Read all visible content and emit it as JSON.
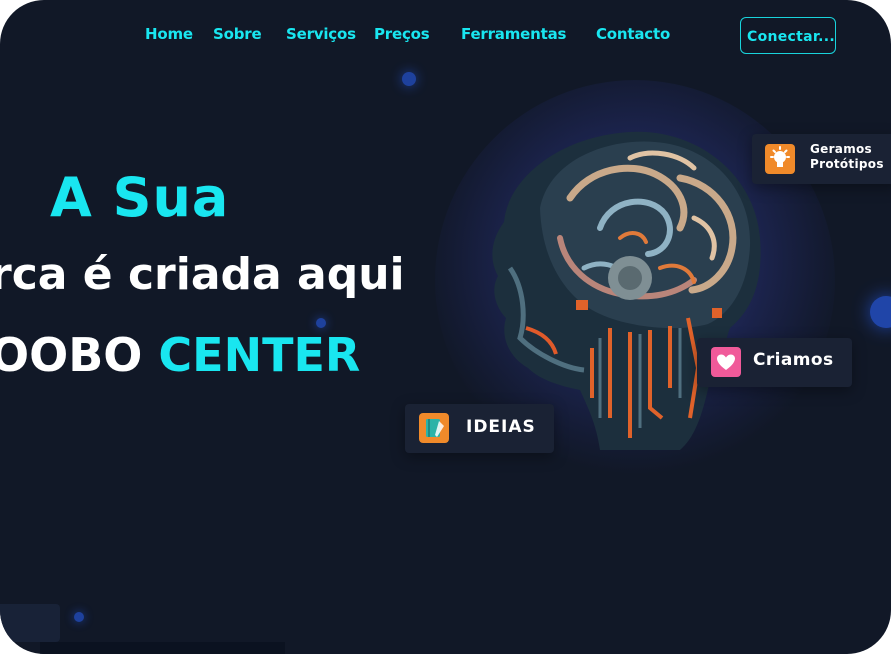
{
  "nav": {
    "links": [
      "Home",
      "Sobre",
      "Serviços",
      "Preços",
      "Ferramentas",
      "Contacto"
    ],
    "connect_label": "Conectar..."
  },
  "hero": {
    "line1": "A Sua",
    "line2": "rca é criada aqui",
    "line3_prefix": "OOBO",
    "line3_accent": "CENTER"
  },
  "badges": {
    "prototypes_line1": "Geramos",
    "prototypes_line2": "Protótipos",
    "criamos": "Criamos",
    "ideias": "IDEIAS"
  },
  "icons": {
    "prototypes": "lightbulb-icon",
    "criamos": "heart-icon",
    "ideias": "notebook-icon",
    "hero_image": "ai-brain-head-illustration"
  },
  "colors": {
    "background": "#111827",
    "accent": "#19e6f0",
    "badge_bg": "#1a2234",
    "orange": "#f08a2a",
    "pink": "#f05a9a"
  }
}
